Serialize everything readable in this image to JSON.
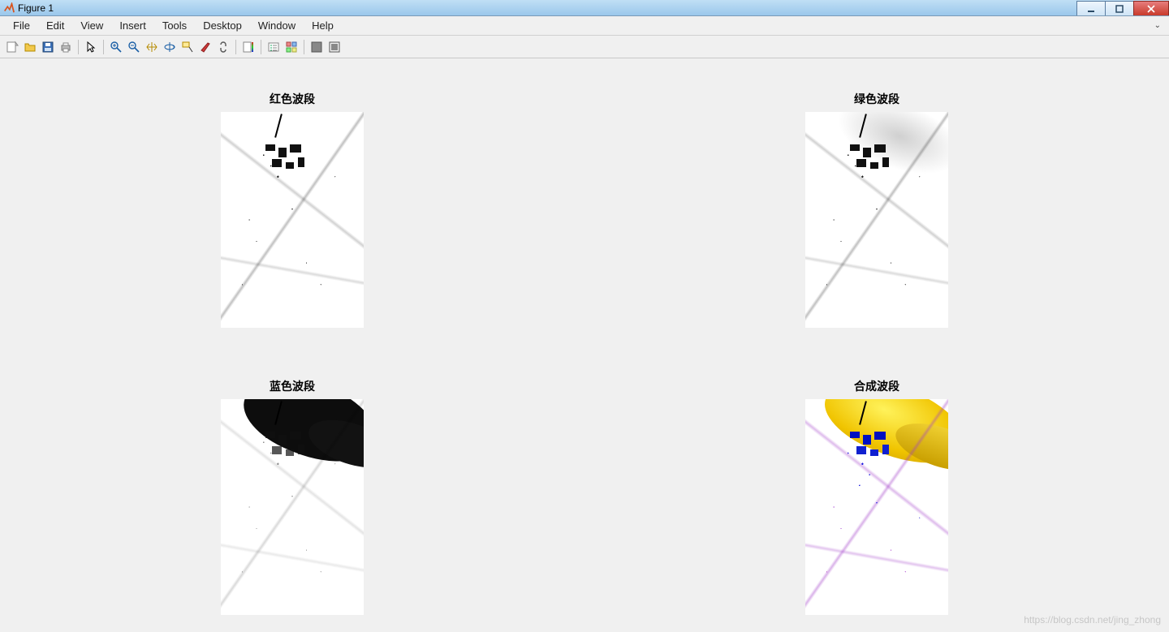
{
  "window": {
    "title": "Figure 1"
  },
  "menus": {
    "file": "File",
    "edit": "Edit",
    "view": "View",
    "insert": "Insert",
    "tools": "Tools",
    "desktop": "Desktop",
    "window": "Window",
    "help": "Help"
  },
  "toolbar": {
    "new": "new-figure-icon",
    "open": "open-icon",
    "save": "save-icon",
    "print": "print-icon",
    "pointer": "pointer-icon",
    "zoom_in": "zoom-in-icon",
    "zoom_out": "zoom-out-icon",
    "pan": "pan-icon",
    "rotate": "rotate-3d-icon",
    "datacursor": "data-cursor-icon",
    "brush": "brush-icon",
    "link": "link-plots-icon",
    "colorbar": "colorbar-icon",
    "legend": "legend-icon",
    "hide": "hide-plot-tools-icon",
    "show": "show-plot-tools-icon"
  },
  "subplots": {
    "p1": {
      "title": "红色波段"
    },
    "p2": {
      "title": "绿色波段"
    },
    "p3": {
      "title": "蓝色波段"
    },
    "p4": {
      "title": "合成波段"
    }
  },
  "watermark": "https://blog.csdn.net/jing_zhong"
}
